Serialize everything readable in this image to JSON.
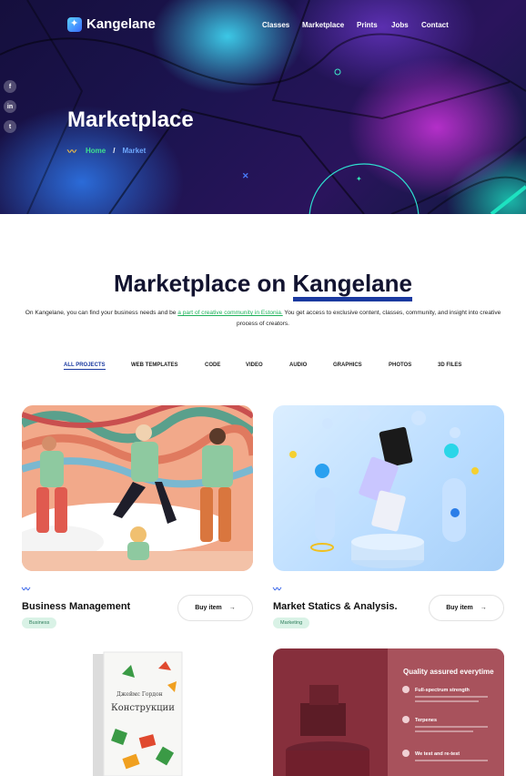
{
  "brand": {
    "name": "Kangelane"
  },
  "nav": {
    "items": [
      "Classes",
      "Marketplace",
      "Prints",
      "Jobs",
      "Contact"
    ]
  },
  "social": {
    "items": [
      "f",
      "in",
      "t"
    ]
  },
  "hero": {
    "title": "Marketplace",
    "breadcrumb": {
      "home": "Home",
      "separator": "/",
      "current": "Market"
    }
  },
  "section": {
    "title_prefix": "Marketplace on ",
    "title_highlight": "Kangelane",
    "intro_before": "On Kangelane, you can find your business needs and be ",
    "intro_link": "a part of creative community in Estonia.",
    "intro_after": " You get access to exclusive content, classes, community, and insight into creative process of creators."
  },
  "filters": [
    "ALL PROJECTS",
    "WEB TEMPLATES",
    "CODE",
    "VIDEO",
    "AUDIO",
    "GRAPHICS",
    "PHOTOS",
    "3D FILES"
  ],
  "products": [
    {
      "title": "Business Management",
      "tag": "Business",
      "button": "Buy item",
      "arrow": "→"
    },
    {
      "title": "Market Statics & Analysis.",
      "tag": "Marketing",
      "button": "Buy item",
      "arrow": "→"
    }
  ],
  "book": {
    "author": "Джеймс Гордон",
    "title": "Конструкции"
  },
  "quality": {
    "heading": "Quality assured everytime",
    "items": [
      "Full-spectrum strength",
      "Terpenes",
      "We test and re-test"
    ]
  },
  "colors": {
    "accent": "#1b3aa0",
    "link": "#1db15a",
    "tag_bg": "#d9f2e6"
  }
}
